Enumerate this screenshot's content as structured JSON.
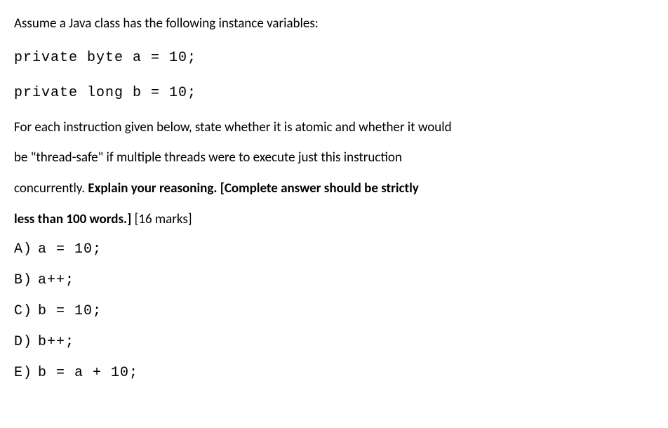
{
  "intro": "Assume a Java class has the following instance variables:",
  "declarations": [
    "private byte a = 10;",
    "private long b = 10;"
  ],
  "question": {
    "line1": "For each instruction given below, state whether it is atomic and whether it would",
    "line2": "be \"thread-safe\" if multiple threads were to execute just this instruction",
    "line3_plain": "concurrently. ",
    "line3_bold": "Explain your reasoning. [Complete answer should be strictly",
    "line4_bold": "less than 100 words.]",
    "line4_plain": " [16 marks]"
  },
  "options": [
    {
      "label": "A)",
      "code": "a = 10;"
    },
    {
      "label": "B)",
      "code": "a++;"
    },
    {
      "label": "C)",
      "code": "b = 10;"
    },
    {
      "label": "D)",
      "code": "b++;"
    },
    {
      "label": "E)",
      "code": "b = a + 10;"
    }
  ]
}
